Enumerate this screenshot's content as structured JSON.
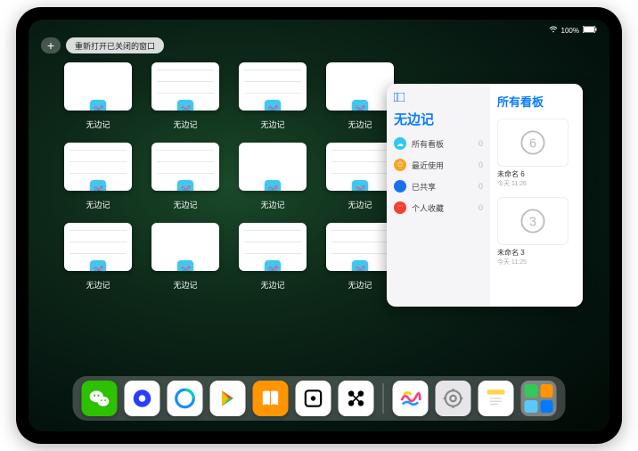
{
  "status": {
    "battery": "100%"
  },
  "topControls": {
    "plus": "+",
    "reopen_label": "重新打开已关闭的窗口"
  },
  "missionApps": [
    {
      "label": "无边记",
      "style": "blank"
    },
    {
      "label": "无边记",
      "style": "grid"
    },
    {
      "label": "无边记",
      "style": "grid"
    },
    {
      "label": "无边记",
      "style": "blank"
    },
    {
      "label": "无边记",
      "style": "grid"
    },
    {
      "label": "无边记",
      "style": "grid"
    },
    {
      "label": "无边记",
      "style": "blank"
    },
    {
      "label": "无边记",
      "style": "grid"
    },
    {
      "label": "无边记",
      "style": "grid"
    },
    {
      "label": "无边记",
      "style": "blank"
    },
    {
      "label": "无边记",
      "style": "grid"
    },
    {
      "label": "无边记",
      "style": "grid"
    }
  ],
  "panel": {
    "title": "无边记",
    "right_title": "所有看板",
    "categories": [
      {
        "icon": "☁",
        "color": "#30c8f0",
        "label": "所有看板",
        "count": "0"
      },
      {
        "icon": "⏱",
        "color": "#f5a623",
        "label": "最近使用",
        "count": "0"
      },
      {
        "icon": "👤",
        "color": "#1a6dff",
        "label": "已共享",
        "count": "0"
      },
      {
        "icon": "♡",
        "color": "#ff3b30",
        "label": "个人收藏",
        "count": "0"
      }
    ],
    "boards": [
      {
        "name": "未命名 6",
        "sub": "今天 11:26",
        "digit": "6"
      },
      {
        "name": "未命名 3",
        "sub": "今天 11:25",
        "digit": "3"
      }
    ]
  },
  "dock": {
    "apps": [
      {
        "name": "wechat",
        "bg": "#2dc100"
      },
      {
        "name": "quark",
        "bg": "#ffffff"
      },
      {
        "name": "qqbrowser",
        "bg": "#ffffff"
      },
      {
        "name": "play",
        "bg": "#ffffff"
      },
      {
        "name": "books",
        "bg": "#ff9500"
      },
      {
        "name": "dice",
        "bg": "#ffffff"
      },
      {
        "name": "dots",
        "bg": "#ffffff"
      },
      {
        "name": "freeform",
        "bg": "#ffffff"
      },
      {
        "name": "settings",
        "bg": "#e5e5ea"
      },
      {
        "name": "notes",
        "bg": "#ffffff"
      }
    ]
  }
}
